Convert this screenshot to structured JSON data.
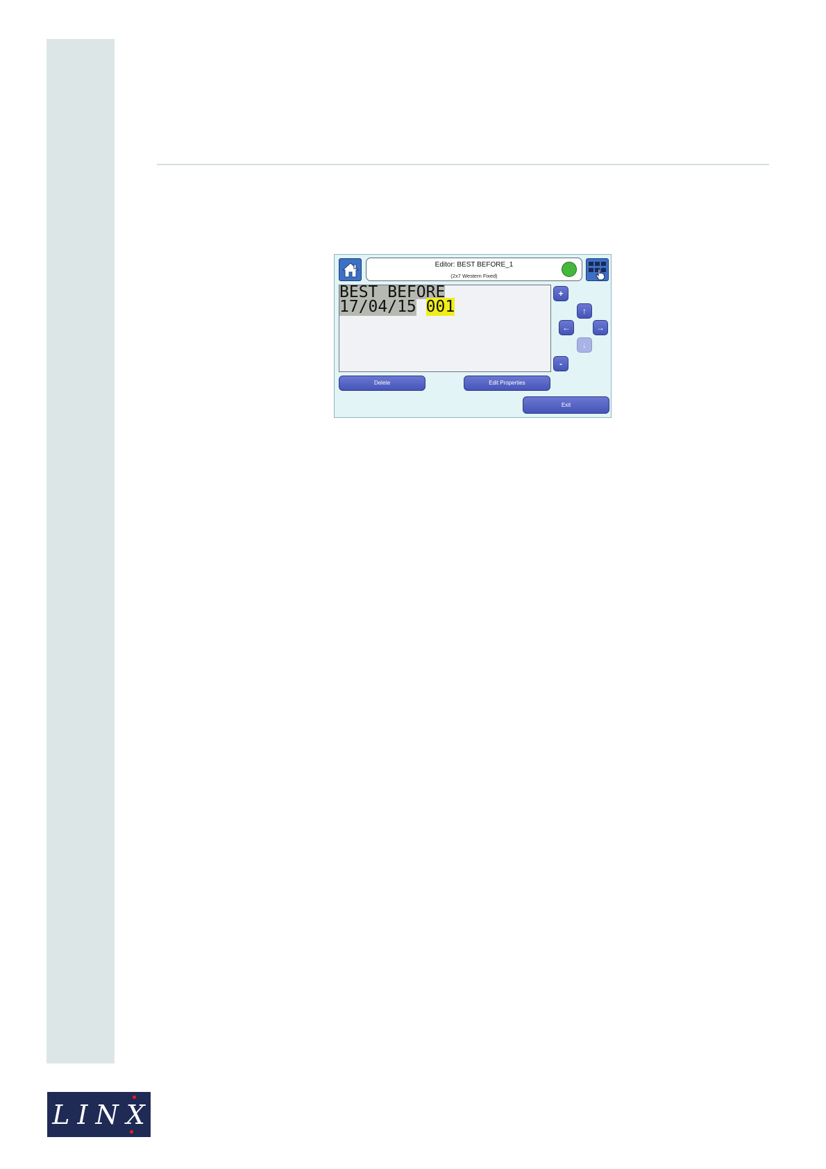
{
  "screen": {
    "title": "Editor: BEST BEFORE_1",
    "subtitle": "(2x7 Western Fixed)",
    "message": {
      "line1": "BEST BEFORE",
      "line2_date": "17/04/15",
      "line2_selected": "001"
    },
    "buttons": {
      "delete": "Delete",
      "edit_properties": "Edit Properties",
      "exit": "Exit",
      "plus": "+",
      "minus": "-",
      "up": "↑",
      "down": "↓",
      "left": "←",
      "right": "→"
    },
    "status_color": "#43b83a"
  },
  "footer": {
    "logo_text": "LINX",
    "logo_bg": "#1f2b55",
    "logo_accent": "#e32026"
  },
  "theme": {
    "side_band": "#dde6e6",
    "button_blue": "#4555b8",
    "selection_yellow": "#f0ee1a"
  }
}
